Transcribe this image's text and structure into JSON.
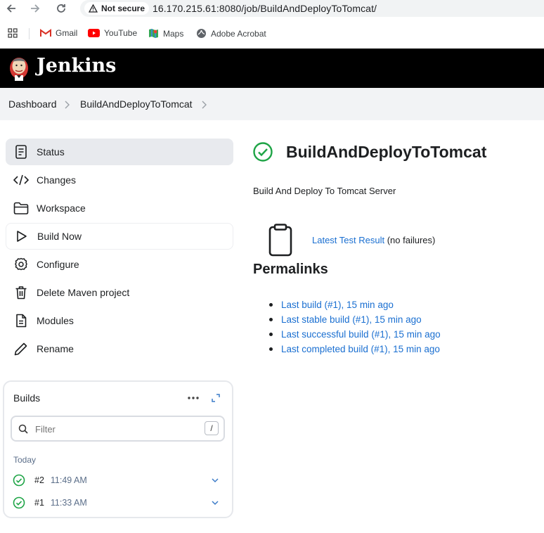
{
  "browser": {
    "security_label": "Not secure",
    "url": "16.170.215.61:8080/job/BuildAndDeployToTomcat/",
    "bookmarks": [
      {
        "label": "Gmail",
        "icon": "gmail-icon"
      },
      {
        "label": "YouTube",
        "icon": "youtube-icon"
      },
      {
        "label": "Maps",
        "icon": "maps-icon"
      },
      {
        "label": "Adobe Acrobat",
        "icon": "acrobat-icon"
      }
    ]
  },
  "header": {
    "app_name": "Jenkins",
    "bg_color": "#000000"
  },
  "breadcrumb": {
    "items": [
      "Dashboard",
      "BuildAndDeployToTomcat"
    ]
  },
  "sidebar": {
    "items": [
      {
        "label": "Status",
        "icon": "document-icon",
        "active": true
      },
      {
        "label": "Changes",
        "icon": "code-icon"
      },
      {
        "label": "Workspace",
        "icon": "folder-icon"
      },
      {
        "label": "Build Now",
        "icon": "play-icon"
      },
      {
        "label": "Configure",
        "icon": "gear-icon"
      },
      {
        "label": "Delete Maven project",
        "icon": "trash-icon"
      },
      {
        "label": "Modules",
        "icon": "file-icon"
      },
      {
        "label": "Rename",
        "icon": "pencil-icon"
      }
    ]
  },
  "builds": {
    "title": "Builds",
    "filter_placeholder": "Filter",
    "filter_shortcut": "/",
    "group_label": "Today",
    "rows": [
      {
        "number": "#2",
        "time": "11:49 AM",
        "status": "success"
      },
      {
        "number": "#1",
        "time": "11:33 AM",
        "status": "success"
      }
    ]
  },
  "main": {
    "title": "BuildAndDeployToTomcat",
    "description": "Build And Deploy To Tomcat Server",
    "test_result_link": "Latest Test Result",
    "test_result_note": "(no failures)",
    "permalinks_title": "Permalinks",
    "permalinks": [
      "Last build (#1), 15 min ago",
      "Last stable build (#1), 15 min ago",
      "Last successful build (#1), 15 min ago",
      "Last completed build (#1), 15 min ago"
    ]
  },
  "colors": {
    "accent": "#1a6fd1",
    "success": "#1ea446",
    "active_bg": "#e8eaee"
  }
}
